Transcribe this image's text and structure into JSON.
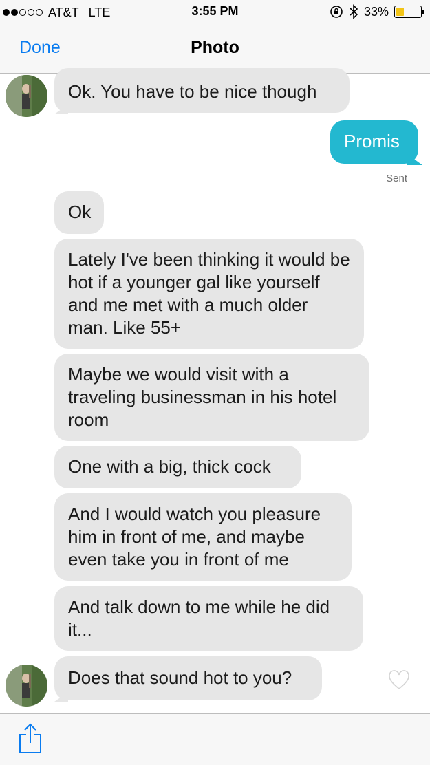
{
  "status_bar": {
    "carrier": "AT&T",
    "network": "LTE",
    "time": "3:55 PM",
    "battery_percent": "33%",
    "battery_level": 0.33,
    "signal_bars_filled": 2,
    "signal_bars_total": 5,
    "icons": [
      "orientation-lock-icon",
      "bluetooth-icon",
      "battery-icon"
    ]
  },
  "nav": {
    "done_label": "Done",
    "title": "Photo"
  },
  "messages": [
    {
      "from": "them",
      "text": "Ok. You have to be nice though",
      "avatar": true
    },
    {
      "from": "me",
      "text": "Promis",
      "receipt": "Sent"
    },
    {
      "from": "them",
      "text": "Ok"
    },
    {
      "from": "them",
      "text": "Lately I've been thinking it would be hot if a younger gal like yourself and me met with a much older man.  Like 55+"
    },
    {
      "from": "them",
      "text": "Maybe we would visit with a traveling businessman in his hotel room"
    },
    {
      "from": "them",
      "text": "One with a big, thick cock"
    },
    {
      "from": "them",
      "text": "And I would watch you pleasure him in front of me, and maybe even take you in front of me"
    },
    {
      "from": "them",
      "text": "And talk down to me while he did it..."
    },
    {
      "from": "them",
      "text": "Does that sound hot to you?",
      "avatar": true,
      "like_icon": "heart-outline-icon"
    }
  ],
  "toolbar": {
    "share_icon": "share-icon"
  },
  "colors": {
    "accent_blue": "#0a7cf0",
    "outgoing_bubble": "#23b8d0",
    "incoming_bubble": "#e6e6e6",
    "battery_fill": "#f2c416"
  }
}
